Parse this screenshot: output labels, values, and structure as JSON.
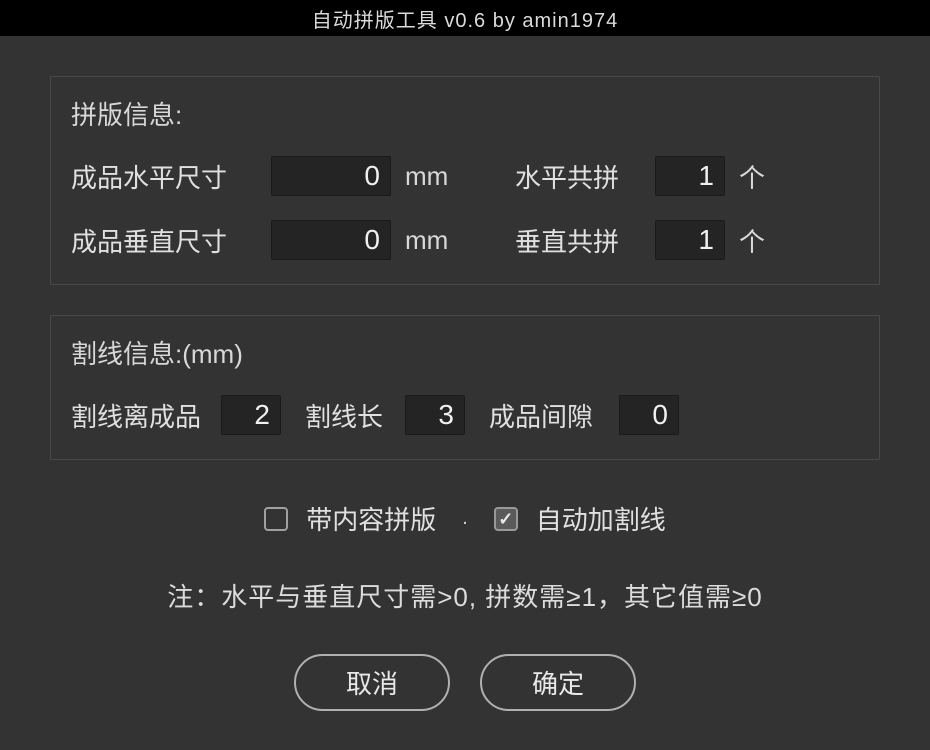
{
  "window": {
    "title": "自动拼版工具 v0.6   by amin1974"
  },
  "group1": {
    "title": "拼版信息:",
    "horiz_size_label": "成品水平尺寸",
    "horiz_size_value": "0",
    "horiz_size_unit": "mm",
    "horiz_count_label": "水平共拼",
    "horiz_count_value": "1",
    "horiz_count_unit": "个",
    "vert_size_label": "成品垂直尺寸",
    "vert_size_value": "0",
    "vert_size_unit": "mm",
    "vert_count_label": "垂直共拼",
    "vert_count_value": "1",
    "vert_count_unit": "个"
  },
  "group2": {
    "title": "割线信息:(mm)",
    "offset_label": "割线离成品",
    "offset_value": "2",
    "length_label": "割线长",
    "length_value": "3",
    "gap_label": "成品间隙",
    "gap_value": "0"
  },
  "options": {
    "with_content_label": "带内容拼版",
    "with_content_checked": false,
    "auto_cutline_label": "自动加割线",
    "auto_cutline_checked": true,
    "separator": "."
  },
  "note": "注：水平与垂直尺寸需>0, 拼数需≥1，其它值需≥0",
  "buttons": {
    "cancel": "取消",
    "ok": "确定"
  }
}
